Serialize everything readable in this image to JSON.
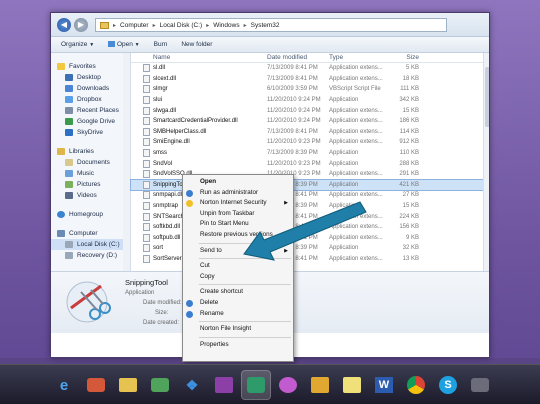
{
  "address": {
    "crumbs": [
      "Computer",
      "Local Disk (C:)",
      "Windows",
      "System32"
    ]
  },
  "toolbar": {
    "organize": "Organize",
    "open": "Open",
    "burn": "Burn",
    "new_folder": "New folder"
  },
  "sidebar": {
    "favorites": "Favorites",
    "fav_items": [
      "Desktop",
      "Downloads",
      "Dropbox",
      "Recent Places",
      "Google Drive",
      "SkyDrive"
    ],
    "libraries": "Libraries",
    "lib_items": [
      "Documents",
      "Music",
      "Pictures",
      "Videos"
    ],
    "homegroup": "Homegroup",
    "computer": "Computer",
    "comp_items": [
      "Local Disk (C:)",
      "Recovery (D:)"
    ]
  },
  "columns": {
    "name": "Name",
    "date": "Date modified",
    "type": "Type",
    "size": "Size"
  },
  "rows": [
    [
      "sl.dll",
      "7/13/2009 8:41 PM",
      "Application extens...",
      "5 KB"
    ],
    [
      "slcext.dll",
      "7/13/2009 8:41 PM",
      "Application extens...",
      "18 KB"
    ],
    [
      "slmgr",
      "6/10/2009 3:59 PM",
      "VBScript Script File",
      "111 KB"
    ],
    [
      "slui",
      "11/20/2010 9:24 PM",
      "Application",
      "342 KB"
    ],
    [
      "slwga.dll",
      "11/20/2010 9:24 PM",
      "Application extens...",
      "15 KB"
    ],
    [
      "SmartcardCredentialProvider.dll",
      "11/20/2010 9:24 PM",
      "Application extens...",
      "186 KB"
    ],
    [
      "SMBHelperClass.dll",
      "7/13/2009 8:41 PM",
      "Application extens...",
      "114 KB"
    ],
    [
      "SmiEngine.dll",
      "11/20/2010 9:23 PM",
      "Application extens...",
      "912 KB"
    ],
    [
      "smss",
      "7/13/2009 8:39 PM",
      "Application",
      "110 KB"
    ],
    [
      "SndVol",
      "11/20/2010 9:23 PM",
      "Application",
      "288 KB"
    ],
    [
      "SndVolSSO.dll",
      "11/20/2010 9:23 PM",
      "Application extens...",
      "291 KB"
    ],
    [
      "SnippingTool",
      "7/13/2009 8:39 PM",
      "Application",
      "421 KB"
    ],
    [
      "snmpapi.dll",
      "7/13/2009 8:41 PM",
      "Application extens...",
      "27 KB"
    ],
    [
      "snmptrap",
      "7/13/2009 8:39 PM",
      "Application",
      "15 KB"
    ],
    [
      "SNTSearch.dll",
      "7/13/2009 8:41 PM",
      "Application extens...",
      "224 KB"
    ],
    [
      "softkbd.dll",
      "7/13/2009 8:41 PM",
      "Application extens...",
      "156 KB"
    ],
    [
      "softpub.dll",
      "7/13/2009 8:41 PM",
      "Application extens...",
      "9 KB"
    ],
    [
      "sort",
      "7/13/2009 8:39 PM",
      "Application",
      "32 KB"
    ],
    [
      "SortServer2003Compat.dll",
      "7/13/2009 8:41 PM",
      "Application extens...",
      "13 KB"
    ]
  ],
  "details": {
    "name": "SnippingTool",
    "type": "Application",
    "date_modified": "Date modified:",
    "size": "Size:",
    "date_created": "Date created:"
  },
  "context_menu": {
    "open": "Open",
    "run_admin": "Run as administrator",
    "norton": "Norton Internet Security",
    "unpin": "Unpin from Taskbar",
    "pin_start": "Pin to Start Menu",
    "restore": "Restore previous versions",
    "send_to": "Send to",
    "cut": "Cut",
    "copy": "Copy",
    "create_shortcut": "Create shortcut",
    "delete": "Delete",
    "rename": "Rename",
    "norton_insight": "Norton File Insight",
    "properties": "Properties"
  },
  "colors": {
    "accent_arrow": "#1f7fa8",
    "selection": "#cde1f7",
    "slide_bg": "#7a60a8"
  },
  "taskbar_icons": [
    "internet-explorer-icon",
    "paint-icon",
    "windows-explorer-icon",
    "games-icon",
    "dropbox-icon",
    "onenote-icon",
    "snipping-tool-icon",
    "network-icon",
    "media-player-icon",
    "sticky-notes-icon",
    "word-icon",
    "chrome-icon",
    "skype-icon",
    "camera-icon"
  ]
}
